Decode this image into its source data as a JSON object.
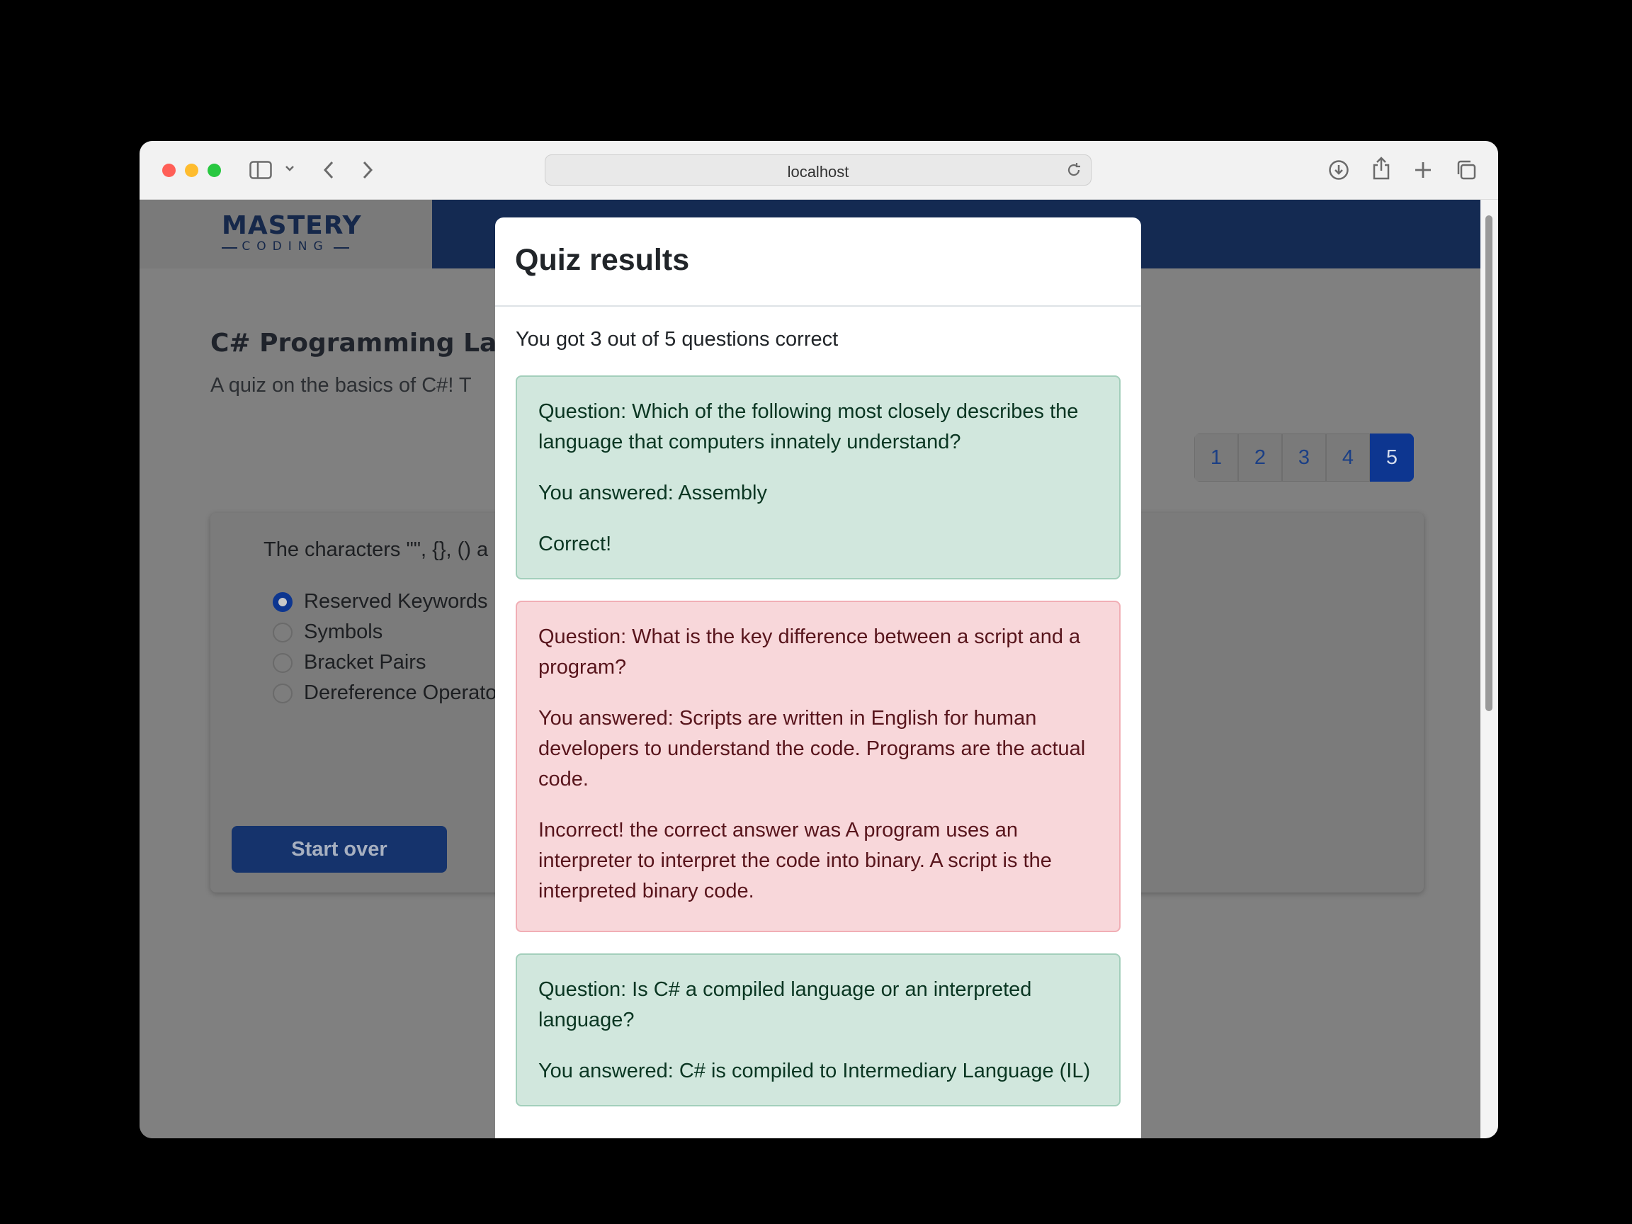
{
  "browser": {
    "url": "localhost"
  },
  "site": {
    "logo_main": "MASTERY",
    "logo_sub": "CODING"
  },
  "quiz": {
    "title": "C# Programming Lan",
    "subtitle": "A quiz on the basics of C#! T",
    "pages": [
      "1",
      "2",
      "3",
      "4",
      "5"
    ],
    "active_page": "5",
    "question": "The characters \"\", {}, () a",
    "options": [
      {
        "label": "Reserved Keywords",
        "checked": true
      },
      {
        "label": "Symbols",
        "checked": false
      },
      {
        "label": "Bracket Pairs",
        "checked": false
      },
      {
        "label": "Dereference Operato",
        "checked": false
      }
    ],
    "start_over_label": "Start over"
  },
  "modal": {
    "title": "Quiz results",
    "score_text": "You got 3 out of 5 questions correct",
    "results": [
      {
        "status": "correct",
        "question": "Question: Which of the following most closely describes the language that computers innately understand?",
        "answered": "You answered: Assembly",
        "verdict": "Correct!"
      },
      {
        "status": "incorrect",
        "question": "Question: What is the key difference between a script and a program?",
        "answered": "You answered: Scripts are written in English for human developers to understand the code. Programs are the actual code.",
        "verdict": "Incorrect! the correct answer was A program uses an interpreter to interpret the code into binary. A script is the interpreted binary code."
      },
      {
        "status": "correct",
        "question": "Question: Is C# a compiled language or an interpreted language?",
        "answered": "You answered: C# is compiled to Intermediary Language (IL)",
        "verdict": ""
      }
    ]
  },
  "colors": {
    "header_navy": "#142a52",
    "primary_blue": "#0d3690",
    "success_bg": "#d1e7dd",
    "danger_bg": "#f8d7da"
  }
}
